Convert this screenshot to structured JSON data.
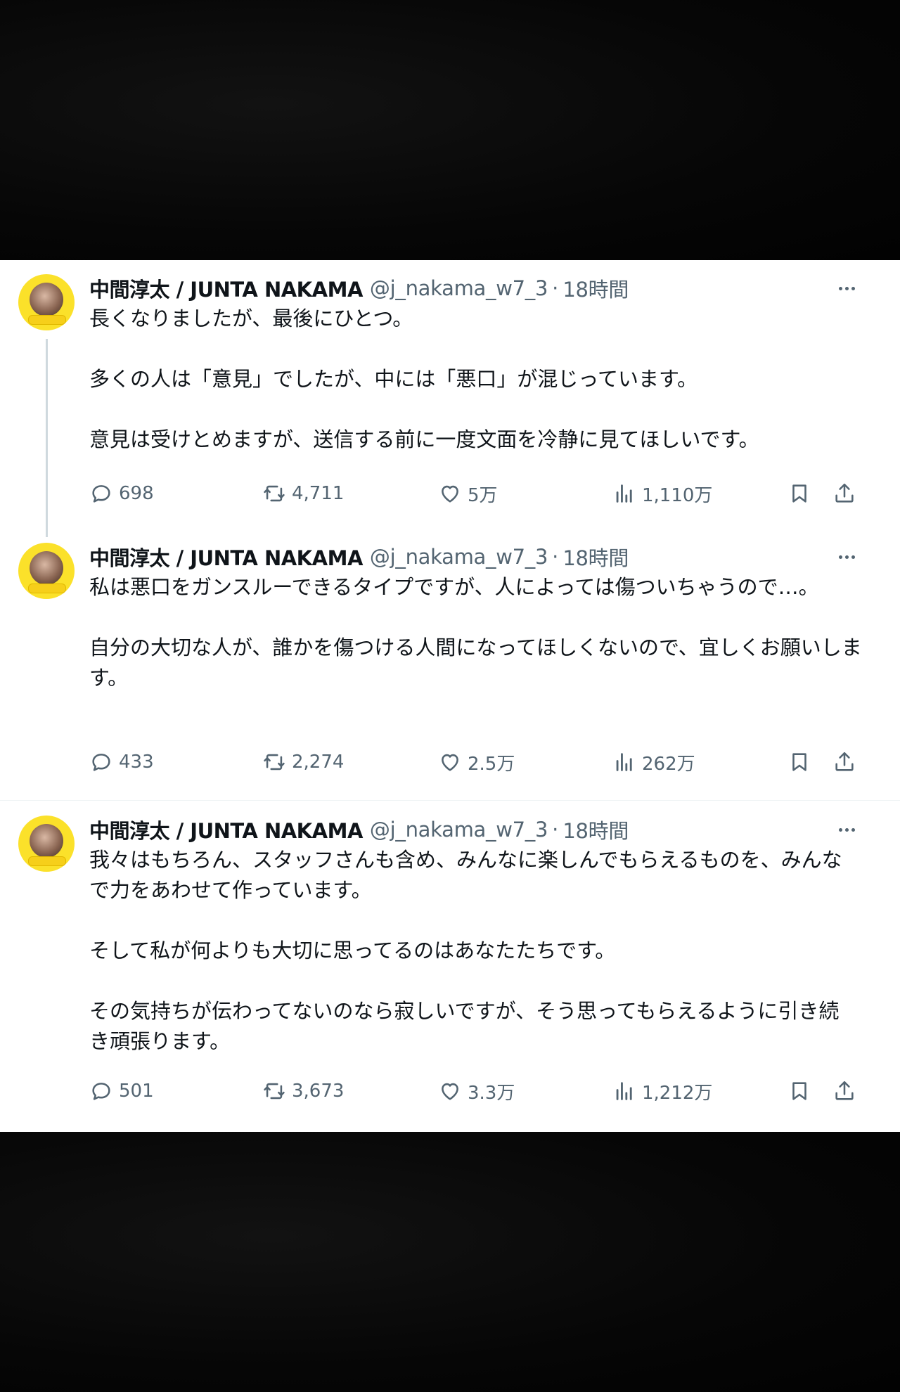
{
  "tweets": [
    {
      "author_name": "中間淳太 / JUNTA NAKAMA",
      "handle": "@j_nakama_w7_3",
      "separator": "·",
      "time": "18時間",
      "paragraphs": [
        "長くなりましたが、最後にひとつ。",
        "多くの人は「意見」でしたが、中には「悪口」が混じっています。",
        "意見は受けとめますが、送信する前に一度文面を冷静に見てほしいです。"
      ],
      "replies": "698",
      "retweets": "4,711",
      "likes": "5万",
      "views": "1,110万"
    },
    {
      "author_name": "中間淳太 / JUNTA NAKAMA",
      "handle": "@j_nakama_w7_3",
      "separator": "·",
      "time": "18時間",
      "paragraphs": [
        "私は悪口をガンスルーできるタイプですが、人によっては傷ついちゃうので…。",
        "自分の大切な人が、誰かを傷つける人間になってほしくないので、宜しくお願いします。"
      ],
      "replies": "433",
      "retweets": "2,274",
      "likes": "2.5万",
      "views": "262万"
    },
    {
      "author_name": "中間淳太 / JUNTA NAKAMA",
      "handle": "@j_nakama_w7_3",
      "separator": "·",
      "time": "18時間",
      "paragraphs": [
        "我々はもちろん、スタッフさんも含め、みんなに楽しんでもらえるものを、みんなで力をあわせて作っています。",
        "そして私が何よりも大切に思ってるのはあなたたちです。",
        "その気持ちが伝わってないのなら寂しいですが、そう思ってもらえるように引き続き頑張ります。"
      ],
      "replies": "501",
      "retweets": "3,673",
      "likes": "3.3万",
      "views": "1,212万"
    }
  ],
  "icons": {
    "reply": "reply-icon",
    "retweet": "retweet-icon",
    "like": "heart-icon",
    "views": "views-icon",
    "bookmark": "bookmark-icon",
    "share": "share-icon",
    "more": "more-icon"
  },
  "colors": {
    "text": "#0f1419",
    "secondary": "#536471",
    "avatar_bg": "#fbe12a",
    "background": "#050505"
  }
}
